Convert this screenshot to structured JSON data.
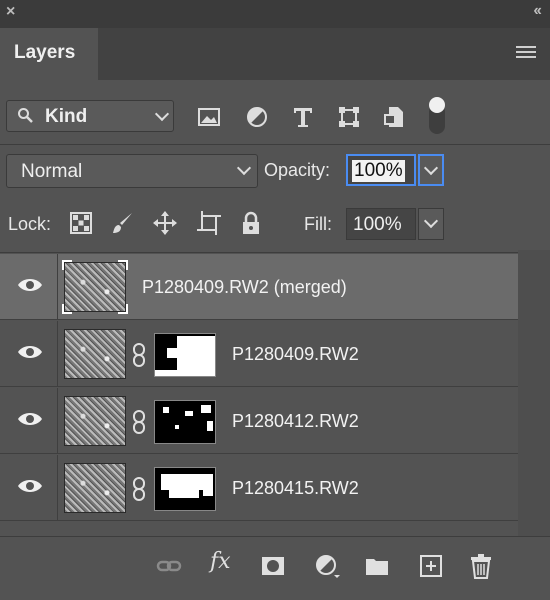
{
  "window": {
    "close_glyph": "×",
    "collapse_glyph": "‹‹"
  },
  "panel": {
    "tab_title": "Layers"
  },
  "filter": {
    "kind_label": "Kind",
    "icons": [
      "pixel-layer-filter-icon",
      "adjustment-layer-filter-icon",
      "type-layer-filter-icon",
      "shape-layer-filter-icon",
      "smart-object-filter-icon",
      "filter-toggle-icon"
    ]
  },
  "blend": {
    "mode": "Normal",
    "opacity_label": "Opacity:",
    "opacity_value": "100%"
  },
  "lock": {
    "label": "Lock:",
    "icons": [
      "lock-transparent-pixels-icon",
      "lock-image-pixels-icon",
      "lock-position-icon",
      "lock-artboard-icon",
      "lock-all-icon"
    ],
    "fill_label": "Fill:",
    "fill_value": "100%"
  },
  "layers": [
    {
      "name": "P1280409.RW2 (merged)",
      "visible": true,
      "selected": true,
      "has_mask": false
    },
    {
      "name": "P1280409.RW2",
      "visible": true,
      "selected": false,
      "has_mask": true
    },
    {
      "name": "P1280412.RW2",
      "visible": true,
      "selected": false,
      "has_mask": true
    },
    {
      "name": "P1280415.RW2",
      "visible": true,
      "selected": false,
      "has_mask": true
    }
  ],
  "footer_icons": [
    "link-layers-icon",
    "fx-icon",
    "add-mask-icon",
    "adjustment-layer-icon",
    "new-group-icon",
    "new-layer-icon",
    "delete-layer-icon"
  ],
  "footer": {
    "fx_label": "fx"
  },
  "colors": {
    "panel_bg": "#535353",
    "selected_row": "#6b6b6b",
    "focus_accent": "#4a8cf2"
  }
}
